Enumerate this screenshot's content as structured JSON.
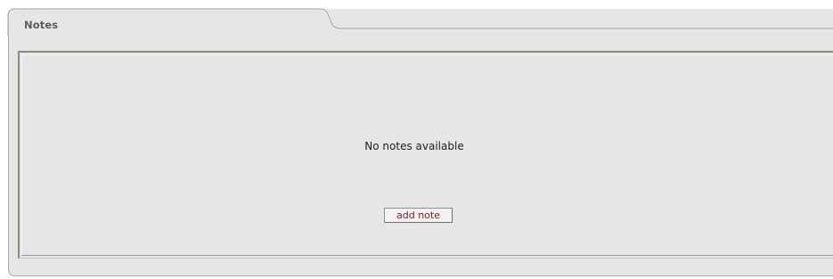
{
  "panel": {
    "tab_title": "Notes"
  },
  "notes": {
    "empty_message": "No notes available",
    "add_button_label": "add note"
  }
}
